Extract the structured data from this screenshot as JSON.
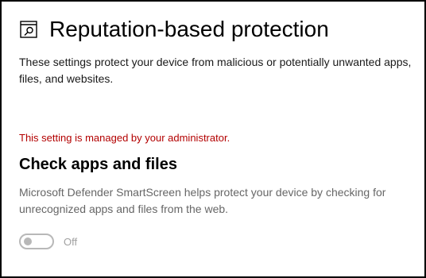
{
  "header": {
    "title": "Reputation-based protection",
    "icon": "app-browser-control-icon"
  },
  "description": "These settings protect your device from malicious or potentially unwanted apps, files, and websites.",
  "managed_notice": "This setting is managed by your administrator.",
  "section": {
    "title": "Check apps and files",
    "description": "Microsoft Defender SmartScreen helps protect your device by checking for unrecognized apps and files from the web.",
    "toggle": {
      "state_label": "Off",
      "on": false,
      "disabled": true
    }
  },
  "colors": {
    "managed_notice": "#b30000",
    "disabled_text": "#a0a0a0",
    "secondary_text": "#666666"
  }
}
